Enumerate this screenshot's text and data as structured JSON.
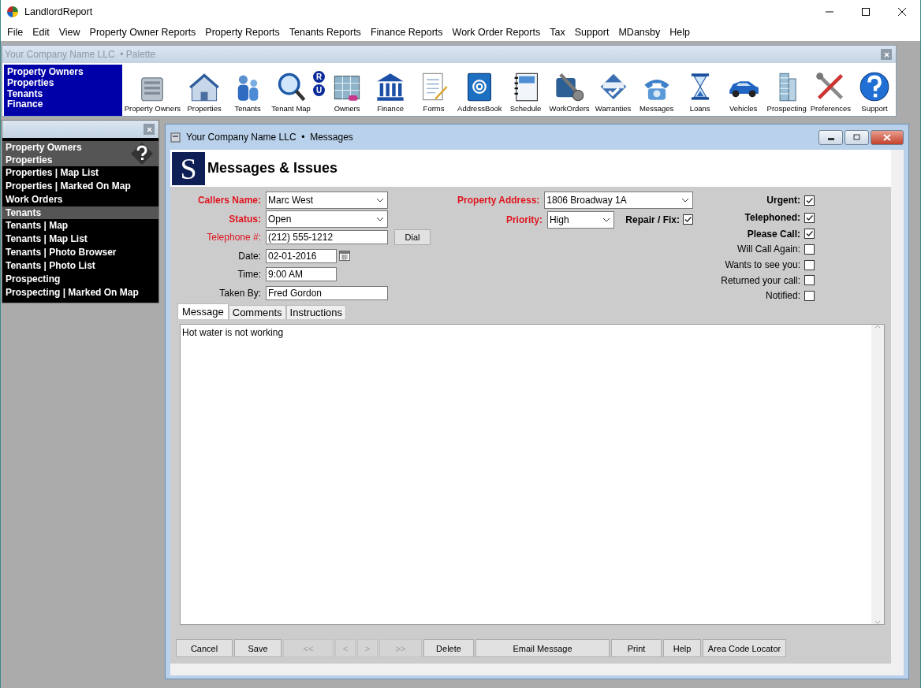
{
  "window": {
    "title": "LandlordReport"
  },
  "menu": [
    "File",
    "Edit",
    "View",
    "Property Owner Reports",
    "Property Reports",
    "Tenants Reports",
    "Finance Reports",
    "Work Order Reports",
    "Tax",
    "Support",
    "MDansby",
    "Help"
  ],
  "palette": {
    "title": "Your Company Name LLC  • Palette",
    "quick_links": [
      "Property Owners",
      "Properties",
      "Tenants",
      "Finance"
    ],
    "ru_badges": [
      "R",
      "U"
    ],
    "tools": [
      {
        "label": "Property Owners"
      },
      {
        "label": "Properties"
      },
      {
        "label": "Tenants"
      },
      {
        "label": "Tenant Map"
      },
      {
        "label": "Owners"
      },
      {
        "label": "Finance"
      },
      {
        "label": "Forms"
      },
      {
        "label": "AddressBook"
      },
      {
        "label": "Schedule"
      },
      {
        "label": "WorkOrders"
      },
      {
        "label": "Warranties"
      },
      {
        "label": "Messages"
      },
      {
        "label": "Loans"
      },
      {
        "label": "Vehicles"
      },
      {
        "label": "Prospecting"
      },
      {
        "label": "Preferences"
      },
      {
        "label": "Support"
      }
    ]
  },
  "sidebar": {
    "items": [
      {
        "label": "Property Owners",
        "kind": "header"
      },
      {
        "label": "Properties",
        "kind": "header"
      },
      {
        "label": "Properties | Map List",
        "kind": "item"
      },
      {
        "label": "Properties | Marked On Map",
        "kind": "item"
      },
      {
        "label": "Work Orders",
        "kind": "item"
      },
      {
        "label": "Tenants",
        "kind": "header"
      },
      {
        "label": "Tenants | Map",
        "kind": "item"
      },
      {
        "label": "Tenants | Map List",
        "kind": "item"
      },
      {
        "label": "Tenants | Photo Browser",
        "kind": "item"
      },
      {
        "label": "Tenants | Photo List",
        "kind": "item"
      },
      {
        "label": "Prospecting",
        "kind": "item"
      },
      {
        "label": "Prospecting | Marked On Map",
        "kind": "item"
      }
    ]
  },
  "document": {
    "title": "Your Company Name LLC  •  Messages",
    "logo_letter": "S",
    "heading": "Messages & Issues",
    "left_fields": [
      {
        "label": "Callers Name:",
        "value": "Marc West",
        "kind": "dropdown",
        "required": true,
        "bold": true
      },
      {
        "label": "Status:",
        "value": "Open",
        "kind": "dropdown",
        "required": true,
        "bold": true
      },
      {
        "label": "Telephone #:",
        "value": "(212) 555-1212",
        "kind": "text",
        "required": true,
        "bold": false,
        "button": "Dial"
      },
      {
        "label": "Date:",
        "value": "02-01-2016",
        "kind": "date",
        "required": false,
        "bold": false
      },
      {
        "label": "Time:",
        "value": "9:00 AM",
        "kind": "short",
        "required": false,
        "bold": false
      },
      {
        "label": "Taken By:",
        "value": "Fred Gordon",
        "kind": "text",
        "required": false,
        "bold": false
      }
    ],
    "property_address": {
      "label": "Property Address:",
      "value": "1806 Broadway 1A"
    },
    "priority": {
      "label": "Priority:",
      "value": "High"
    },
    "repair": {
      "label": "Repair / Fix:",
      "checked": true
    },
    "flags": [
      {
        "label": "Urgent:",
        "checked": true,
        "bold": true
      },
      {
        "label": "Telephoned:",
        "checked": true,
        "bold": true
      },
      {
        "label": "Please Call:",
        "checked": true,
        "bold": true
      },
      {
        "label": "Will Call Again:",
        "checked": false,
        "bold": false
      },
      {
        "label": "Wants to see you:",
        "checked": false,
        "bold": false
      },
      {
        "label": "Returned your call:",
        "checked": false,
        "bold": false
      },
      {
        "label": "Notified:",
        "checked": false,
        "bold": false
      }
    ],
    "tabs": [
      {
        "label": "Message",
        "selected": true
      },
      {
        "label": "Comments",
        "selected": false
      },
      {
        "label": "Instructions",
        "selected": false
      }
    ],
    "message": "Hot water is not working",
    "buttons": [
      {
        "label": "Cancel",
        "disabled": false
      },
      {
        "label": "Save",
        "disabled": false
      },
      {
        "label": "<<",
        "disabled": true
      },
      {
        "label": "<",
        "disabled": true
      },
      {
        "label": ">",
        "disabled": true
      },
      {
        "label": ">>",
        "disabled": true
      },
      {
        "label": "Delete",
        "disabled": false
      },
      {
        "label": "Email Message",
        "disabled": false
      },
      {
        "label": "Print",
        "disabled": false
      },
      {
        "label": "Help",
        "disabled": false
      },
      {
        "label": "Area Code Locator",
        "disabled": false
      }
    ]
  }
}
